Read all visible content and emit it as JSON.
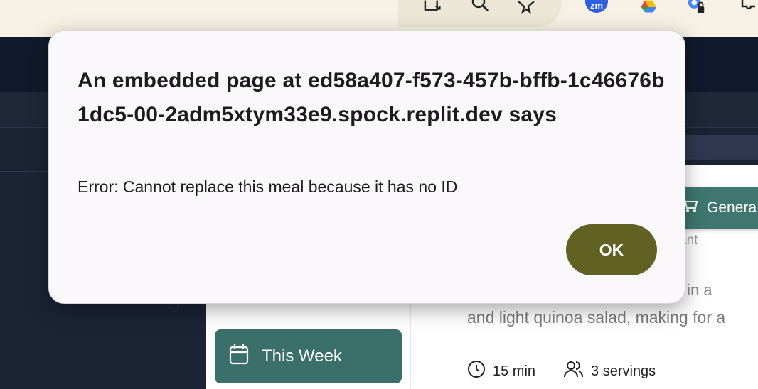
{
  "browser": {
    "extensions": [
      "cast-icon",
      "zoom-icon",
      "bookmark-star-icon",
      "zm-extension-icon",
      "google-drive-icon",
      "chrome-profile-lock-icon",
      "extensions-puzzle-icon"
    ],
    "zm_label": "zm"
  },
  "app": {
    "generate_label": "Genera",
    "subtitle_peek": "ant",
    "description_peek": "nated in a",
    "description_line2": "and light quinoa salad, making for a",
    "time": "15 min",
    "servings": "3 servings",
    "this_week_label": "This Week"
  },
  "dialog": {
    "title": "An embedded page at ed58a407-f573-457b-bffb-1c46676b1dc5-00-2adm5xtym33e9.spock.replit.dev says",
    "message": "Error: Cannot replace this meal because it has no ID",
    "ok_label": "OK"
  },
  "colors": {
    "accent_teal": "#3a6f6a",
    "ok_button": "#616123",
    "dark_bg": "#1b2233"
  }
}
